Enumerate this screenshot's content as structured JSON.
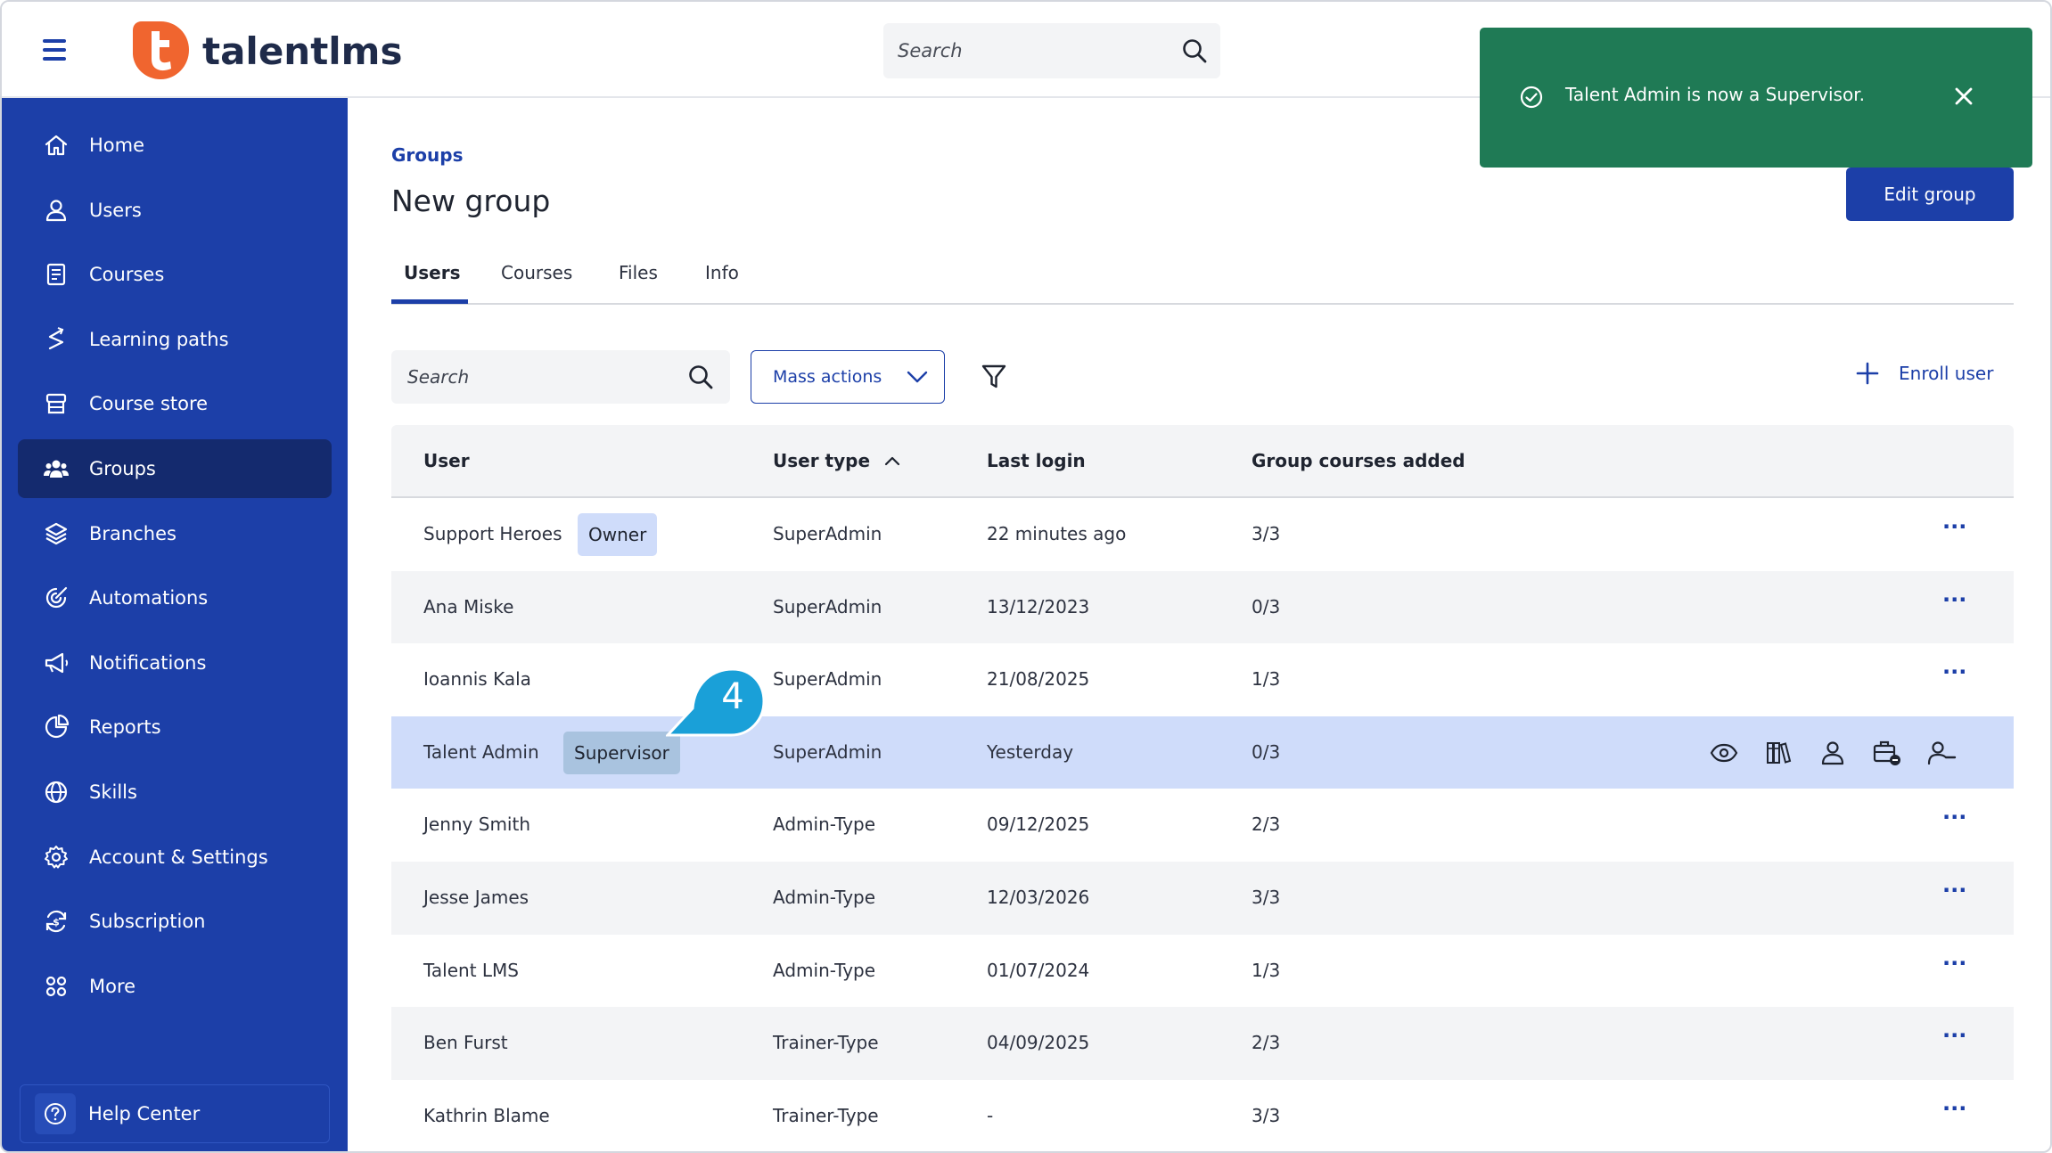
{
  "header": {
    "logo_text": "talentlms",
    "search_placeholder": "Search"
  },
  "sidebar": {
    "items": [
      {
        "label": "Home",
        "icon": "home-icon"
      },
      {
        "label": "Users",
        "icon": "user-icon"
      },
      {
        "label": "Courses",
        "icon": "book-icon"
      },
      {
        "label": "Learning paths",
        "icon": "path-icon"
      },
      {
        "label": "Course store",
        "icon": "store-icon"
      },
      {
        "label": "Groups",
        "icon": "groups-icon",
        "active": true
      },
      {
        "label": "Branches",
        "icon": "layers-icon"
      },
      {
        "label": "Automations",
        "icon": "automation-icon"
      },
      {
        "label": "Notifications",
        "icon": "megaphone-icon"
      },
      {
        "label": "Reports",
        "icon": "pie-chart-icon"
      },
      {
        "label": "Skills",
        "icon": "globe-icon"
      },
      {
        "label": "Account & Settings",
        "icon": "gear-icon"
      },
      {
        "label": "Subscription",
        "icon": "subscription-icon"
      },
      {
        "label": "More",
        "icon": "grid-icon"
      }
    ],
    "help_label": "Help Center"
  },
  "main": {
    "breadcrumb": "Groups",
    "title": "New group",
    "edit_button": "Edit group",
    "tabs": [
      {
        "label": "Users",
        "active": true
      },
      {
        "label": "Courses"
      },
      {
        "label": "Files"
      },
      {
        "label": "Info"
      }
    ],
    "toolbar": {
      "search_placeholder": "Search",
      "mass_actions": "Mass actions",
      "enroll_user": "Enroll user"
    },
    "table": {
      "headers": {
        "user": "User",
        "user_type": "User type",
        "last_login": "Last login",
        "group_courses": "Group courses added"
      },
      "rows": [
        {
          "user": "Support Heroes",
          "badge": "Owner",
          "type": "SuperAdmin",
          "login": "22 minutes ago",
          "courses": "3/3"
        },
        {
          "user": "Ana Miske",
          "type": "SuperAdmin",
          "login": "13/12/2023",
          "courses": "0/3"
        },
        {
          "user": "Ioannis Kala",
          "type": "SuperAdmin",
          "login": "21/08/2025",
          "courses": "1/3"
        },
        {
          "user": "Talent Admin",
          "badge": "Supervisor",
          "type": "SuperAdmin",
          "login": "Yesterday",
          "courses": "0/3",
          "selected": true
        },
        {
          "user": "Jenny Smith",
          "type": "Admin-Type",
          "login": "09/12/2025",
          "courses": "2/3"
        },
        {
          "user": "Jesse James",
          "type": "Admin-Type",
          "login": "12/03/2026",
          "courses": "3/3"
        },
        {
          "user": "Talent LMS",
          "type": "Admin-Type",
          "login": "01/07/2024",
          "courses": "1/3"
        },
        {
          "user": "Ben Furst",
          "type": "Trainer-Type",
          "login": "04/09/2025",
          "courses": "2/3"
        },
        {
          "user": "Kathrin Blame",
          "type": "Trainer-Type",
          "login": "-",
          "courses": "3/3"
        }
      ],
      "row_menu": "···"
    }
  },
  "callout_number": "4",
  "toast": {
    "message": "Talent Admin is now a Supervisor."
  },
  "colors": {
    "primary": "#1c3fa8",
    "sidebar_active": "#142a6e",
    "toast": "#1f7a55",
    "selected_row": "#cfdcfa",
    "callout": "#1aa0d8",
    "logo_orange": "#f0652f"
  }
}
